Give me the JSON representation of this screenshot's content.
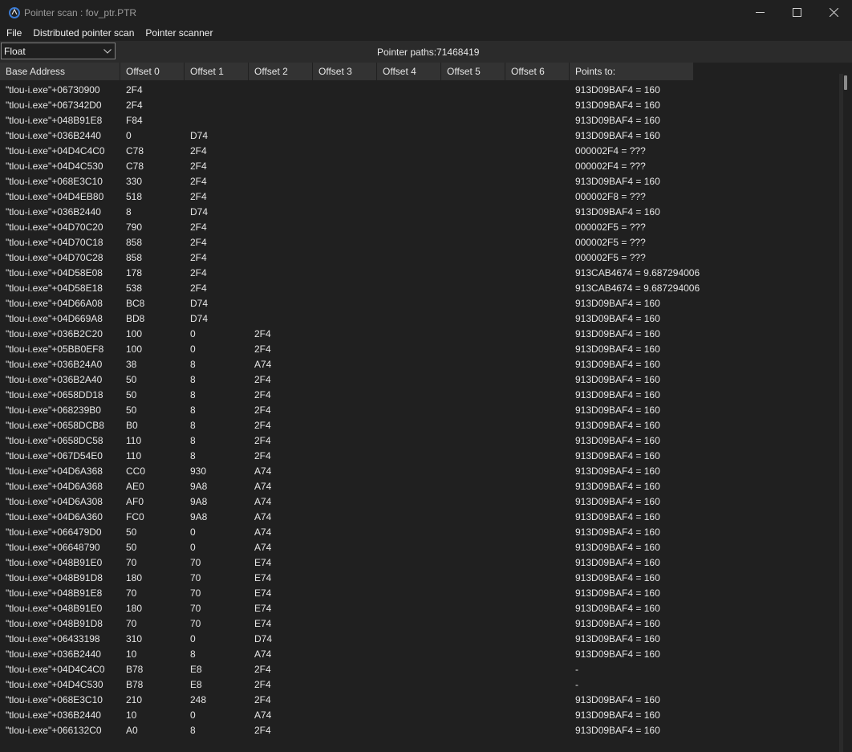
{
  "window": {
    "title": "Pointer scan : fov_ptr.PTR",
    "minimize": "─",
    "maximize": "☐",
    "close": "✕"
  },
  "menu": [
    "File",
    "Distributed pointer scan",
    "Pointer scanner"
  ],
  "toolbar": {
    "type_value": "Float",
    "pointer_paths": "Pointer paths:71468419"
  },
  "columns": [
    "Base Address",
    "Offset 0",
    "Offset 1",
    "Offset 2",
    "Offset 3",
    "Offset 4",
    "Offset 5",
    "Offset 6",
    "Points to:"
  ],
  "rows": [
    [
      "\"tlou-i.exe\"+06730900",
      "2F4",
      "",
      "",
      "",
      "",
      "",
      "",
      "913D09BAF4 = 160"
    ],
    [
      "\"tlou-i.exe\"+067342D0",
      "2F4",
      "",
      "",
      "",
      "",
      "",
      "",
      "913D09BAF4 = 160"
    ],
    [
      "\"tlou-i.exe\"+048B91E8",
      "F84",
      "",
      "",
      "",
      "",
      "",
      "",
      "913D09BAF4 = 160"
    ],
    [
      "\"tlou-i.exe\"+036B2440",
      "0",
      "D74",
      "",
      "",
      "",
      "",
      "",
      "913D09BAF4 = 160"
    ],
    [
      "\"tlou-i.exe\"+04D4C4C0",
      "C78",
      "2F4",
      "",
      "",
      "",
      "",
      "",
      "000002F4 = ???"
    ],
    [
      "\"tlou-i.exe\"+04D4C530",
      "C78",
      "2F4",
      "",
      "",
      "",
      "",
      "",
      "000002F4 = ???"
    ],
    [
      "\"tlou-i.exe\"+068E3C10",
      "330",
      "2F4",
      "",
      "",
      "",
      "",
      "",
      "913D09BAF4 = 160"
    ],
    [
      "\"tlou-i.exe\"+04D4EB80",
      "518",
      "2F4",
      "",
      "",
      "",
      "",
      "",
      "000002F8 = ???"
    ],
    [
      "\"tlou-i.exe\"+036B2440",
      "8",
      "D74",
      "",
      "",
      "",
      "",
      "",
      "913D09BAF4 = 160"
    ],
    [
      "\"tlou-i.exe\"+04D70C20",
      "790",
      "2F4",
      "",
      "",
      "",
      "",
      "",
      "000002F5 = ???"
    ],
    [
      "\"tlou-i.exe\"+04D70C18",
      "858",
      "2F4",
      "",
      "",
      "",
      "",
      "",
      "000002F5 = ???"
    ],
    [
      "\"tlou-i.exe\"+04D70C28",
      "858",
      "2F4",
      "",
      "",
      "",
      "",
      "",
      "000002F5 = ???"
    ],
    [
      "\"tlou-i.exe\"+04D58E08",
      "178",
      "2F4",
      "",
      "",
      "",
      "",
      "",
      "913CAB4674 = 9.687294006"
    ],
    [
      "\"tlou-i.exe\"+04D58E18",
      "538",
      "2F4",
      "",
      "",
      "",
      "",
      "",
      "913CAB4674 = 9.687294006"
    ],
    [
      "\"tlou-i.exe\"+04D66A08",
      "BC8",
      "D74",
      "",
      "",
      "",
      "",
      "",
      "913D09BAF4 = 160"
    ],
    [
      "\"tlou-i.exe\"+04D669A8",
      "BD8",
      "D74",
      "",
      "",
      "",
      "",
      "",
      "913D09BAF4 = 160"
    ],
    [
      "\"tlou-i.exe\"+036B2C20",
      "100",
      "0",
      "2F4",
      "",
      "",
      "",
      "",
      "913D09BAF4 = 160"
    ],
    [
      "\"tlou-i.exe\"+05BB0EF8",
      "100",
      "0",
      "2F4",
      "",
      "",
      "",
      "",
      "913D09BAF4 = 160"
    ],
    [
      "\"tlou-i.exe\"+036B24A0",
      "38",
      "8",
      "A74",
      "",
      "",
      "",
      "",
      "913D09BAF4 = 160"
    ],
    [
      "\"tlou-i.exe\"+036B2A40",
      "50",
      "8",
      "2F4",
      "",
      "",
      "",
      "",
      "913D09BAF4 = 160"
    ],
    [
      "\"tlou-i.exe\"+0658DD18",
      "50",
      "8",
      "2F4",
      "",
      "",
      "",
      "",
      "913D09BAF4 = 160"
    ],
    [
      "\"tlou-i.exe\"+068239B0",
      "50",
      "8",
      "2F4",
      "",
      "",
      "",
      "",
      "913D09BAF4 = 160"
    ],
    [
      "\"tlou-i.exe\"+0658DCB8",
      "B0",
      "8",
      "2F4",
      "",
      "",
      "",
      "",
      "913D09BAF4 = 160"
    ],
    [
      "\"tlou-i.exe\"+0658DC58",
      "110",
      "8",
      "2F4",
      "",
      "",
      "",
      "",
      "913D09BAF4 = 160"
    ],
    [
      "\"tlou-i.exe\"+067D54E0",
      "110",
      "8",
      "2F4",
      "",
      "",
      "",
      "",
      "913D09BAF4 = 160"
    ],
    [
      "\"tlou-i.exe\"+04D6A368",
      "CC0",
      "930",
      "A74",
      "",
      "",
      "",
      "",
      "913D09BAF4 = 160"
    ],
    [
      "\"tlou-i.exe\"+04D6A368",
      "AE0",
      "9A8",
      "A74",
      "",
      "",
      "",
      "",
      "913D09BAF4 = 160"
    ],
    [
      "\"tlou-i.exe\"+04D6A308",
      "AF0",
      "9A8",
      "A74",
      "",
      "",
      "",
      "",
      "913D09BAF4 = 160"
    ],
    [
      "\"tlou-i.exe\"+04D6A360",
      "FC0",
      "9A8",
      "A74",
      "",
      "",
      "",
      "",
      "913D09BAF4 = 160"
    ],
    [
      "\"tlou-i.exe\"+066479D0",
      "50",
      "0",
      "A74",
      "",
      "",
      "",
      "",
      "913D09BAF4 = 160"
    ],
    [
      "\"tlou-i.exe\"+06648790",
      "50",
      "0",
      "A74",
      "",
      "",
      "",
      "",
      "913D09BAF4 = 160"
    ],
    [
      "\"tlou-i.exe\"+048B91E0",
      "70",
      "70",
      "E74",
      "",
      "",
      "",
      "",
      "913D09BAF4 = 160"
    ],
    [
      "\"tlou-i.exe\"+048B91D8",
      "180",
      "70",
      "E74",
      "",
      "",
      "",
      "",
      "913D09BAF4 = 160"
    ],
    [
      "\"tlou-i.exe\"+048B91E8",
      "70",
      "70",
      "E74",
      "",
      "",
      "",
      "",
      "913D09BAF4 = 160"
    ],
    [
      "\"tlou-i.exe\"+048B91E0",
      "180",
      "70",
      "E74",
      "",
      "",
      "",
      "",
      "913D09BAF4 = 160"
    ],
    [
      "\"tlou-i.exe\"+048B91D8",
      "70",
      "70",
      "E74",
      "",
      "",
      "",
      "",
      "913D09BAF4 = 160"
    ],
    [
      "\"tlou-i.exe\"+06433198",
      "310",
      "0",
      "D74",
      "",
      "",
      "",
      "",
      "913D09BAF4 = 160"
    ],
    [
      "\"tlou-i.exe\"+036B2440",
      "10",
      "8",
      "A74",
      "",
      "",
      "",
      "",
      "913D09BAF4 = 160"
    ],
    [
      "\"tlou-i.exe\"+04D4C4C0",
      "B78",
      "E8",
      "2F4",
      "",
      "",
      "",
      "",
      "-"
    ],
    [
      "\"tlou-i.exe\"+04D4C530",
      "B78",
      "E8",
      "2F4",
      "",
      "",
      "",
      "",
      "-"
    ],
    [
      "\"tlou-i.exe\"+068E3C10",
      "210",
      "248",
      "2F4",
      "",
      "",
      "",
      "",
      "913D09BAF4 = 160"
    ],
    [
      "\"tlou-i.exe\"+036B2440",
      "10",
      "0",
      "A74",
      "",
      "",
      "",
      "",
      "913D09BAF4 = 160"
    ],
    [
      "\"tlou-i.exe\"+066132C0",
      "A0",
      "8",
      "2F4",
      "",
      "",
      "",
      "",
      "913D09BAF4 = 160"
    ]
  ],
  "icons": {
    "app": "cheat-engine-icon",
    "combo_arrow": "chevron-down-icon"
  }
}
